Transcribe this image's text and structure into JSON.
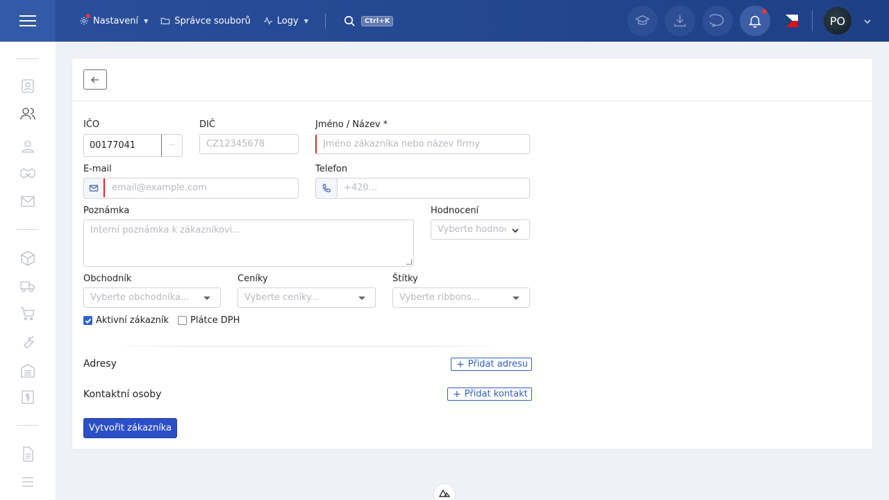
{
  "topbar": {
    "nav": [
      {
        "label": "Nastavení",
        "icon": "gear-icon",
        "has_caret": true,
        "has_dot": true
      },
      {
        "label": "Správce souborů",
        "icon": "folder-icon",
        "has_caret": false
      },
      {
        "label": "Logy",
        "icon": "activity-icon",
        "has_caret": true
      }
    ],
    "search_shortcut": "Ctrl+K",
    "avatar_initials": "PO",
    "language": "cs"
  },
  "form": {
    "ico": {
      "label": "IČO",
      "value": "00177041"
    },
    "dic": {
      "label": "DIČ",
      "placeholder": "CZ12345678"
    },
    "name": {
      "label": "Jméno / Název *",
      "placeholder": "Jméno zákazníka nebo název firmy"
    },
    "email": {
      "label": "E-mail",
      "placeholder": "email@example.com"
    },
    "phone": {
      "label": "Telefon",
      "placeholder": "+420..."
    },
    "note": {
      "label": "Poznámka",
      "placeholder": "Interní poznámka k zákazníkovi..."
    },
    "rating": {
      "label": "Hodnocení",
      "placeholder": "Vyberte hodnocení"
    },
    "salesman": {
      "label": "Obchodník",
      "placeholder": "Vyberte obchodníka..."
    },
    "pricelists": {
      "label": "Ceníky",
      "placeholder": "Vyberte ceníky..."
    },
    "tags": {
      "label": "Štítky",
      "placeholder": "Vyberte ribbons..."
    },
    "active": {
      "label": "Aktivní zákazník",
      "checked": true
    },
    "vat_payer": {
      "label": "Plátce DPH",
      "checked": false
    },
    "addresses": {
      "title": "Adresy",
      "add_label": "Přidat adresu"
    },
    "contacts": {
      "title": "Kontaktní osoby",
      "add_label": "Přidat kontakt"
    },
    "submit_label": "Vytvořit zákazníka"
  },
  "colors": {
    "primary": "#2b4fc7",
    "topbar": "#23468f",
    "invalid": "#d12c2c"
  }
}
